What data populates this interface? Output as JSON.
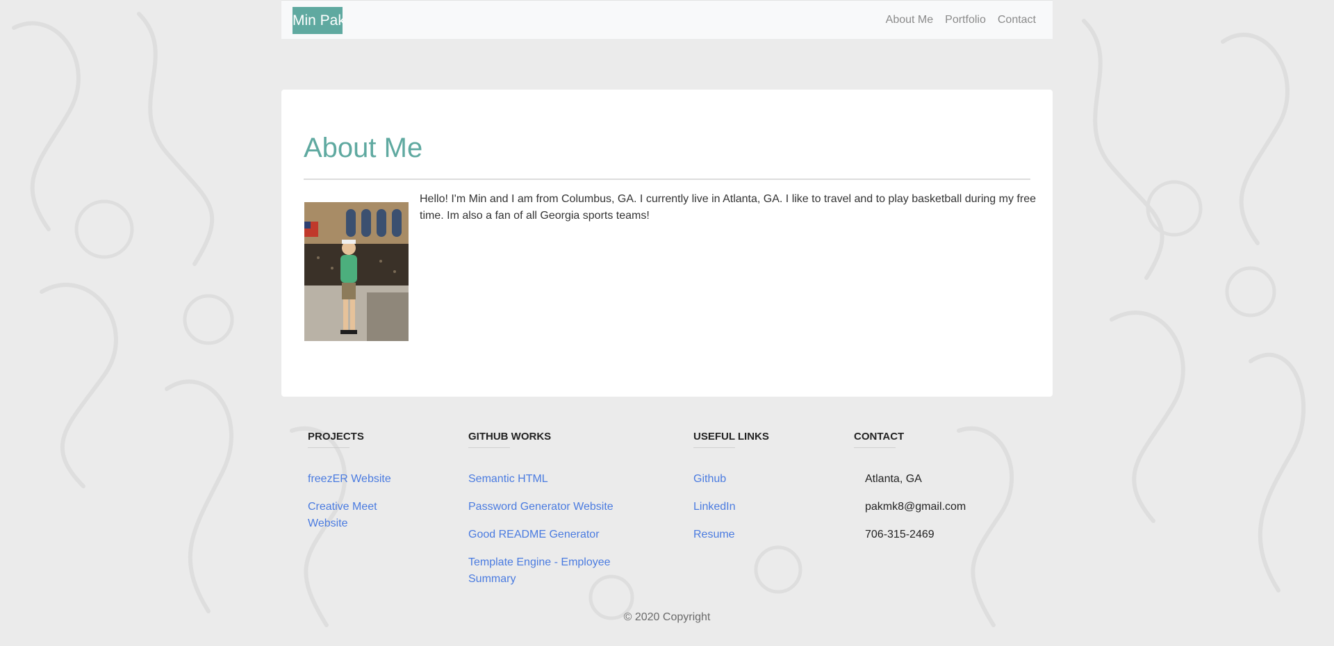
{
  "nav": {
    "brand": "Min Pak",
    "links": [
      "About Me",
      "Portfolio",
      "Contact"
    ]
  },
  "about": {
    "title": "About Me",
    "bio": "Hello! I'm Min and I am from Columbus, GA. I currently live in Atlanta, GA. I like to travel and to play basketball during my free time. Im also a fan of all Georgia sports teams!"
  },
  "footer": {
    "projects": {
      "heading": "PROJECTS",
      "links": [
        "freezER Website",
        "Creative Meet Website"
      ]
    },
    "github": {
      "heading": "GITHUB WORKS",
      "links": [
        "Semantic HTML",
        "Password Generator Website",
        "Good README Generator",
        "Template Engine - Employee Summary"
      ]
    },
    "useful": {
      "heading": "USEFUL LINKS",
      "links": [
        "Github",
        "LinkedIn",
        "Resume"
      ]
    },
    "contact": {
      "heading": "CONTACT",
      "items": [
        "Atlanta, GA",
        "pakmk8@gmail.com",
        "706-315-2469"
      ]
    },
    "copyright": "© 2020 Copyright"
  },
  "colors": {
    "accent": "#5fa9a0",
    "link": "#4a7be0",
    "navbar_bg": "#f8f9fa",
    "page_bg": "#ebebeb"
  }
}
